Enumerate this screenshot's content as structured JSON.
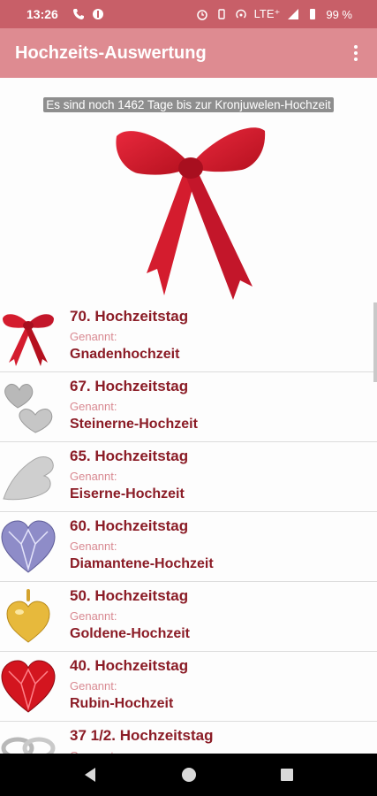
{
  "status": {
    "time": "13:26",
    "battery": "99 %"
  },
  "appbar": {
    "title": "Hochzeits-Auswertung"
  },
  "banner": {
    "text": "Es sind noch 1462 Tage bis zur Kronjuwelen-Hochzeit"
  },
  "list": {
    "items": [
      {
        "title": "70. Hochzeitstag",
        "sub": "Genannt:",
        "name": "Gnadenhochzeit",
        "icon": "red-bow"
      },
      {
        "title": "67. Hochzeitstag",
        "sub": "Genannt:",
        "name": "Steinerne-Hochzeit",
        "icon": "stone-hearts"
      },
      {
        "title": "65. Hochzeitstag",
        "sub": "Genannt:",
        "name": "Eiserne-Hochzeit",
        "icon": "iron-heart"
      },
      {
        "title": "60. Hochzeitstag",
        "sub": "Genannt:",
        "name": "Diamantene-Hochzeit",
        "icon": "diamond-heart"
      },
      {
        "title": "50. Hochzeitstag",
        "sub": "Genannt:",
        "name": "Goldene-Hochzeit",
        "icon": "gold-heart-pendant"
      },
      {
        "title": "40. Hochzeitstag",
        "sub": "Genannt:",
        "name": "Rubin-Hochzeit",
        "icon": "ruby-heart"
      },
      {
        "title": "37 1/2. Hochzeitstag",
        "sub": "Genannt:",
        "name": "",
        "icon": "silver-rings"
      }
    ]
  },
  "colors": {
    "statusbar": "#c85f68",
    "appbar": "#de8b91",
    "title_text": "#8b1c26",
    "sub_text": "#d98a92"
  }
}
